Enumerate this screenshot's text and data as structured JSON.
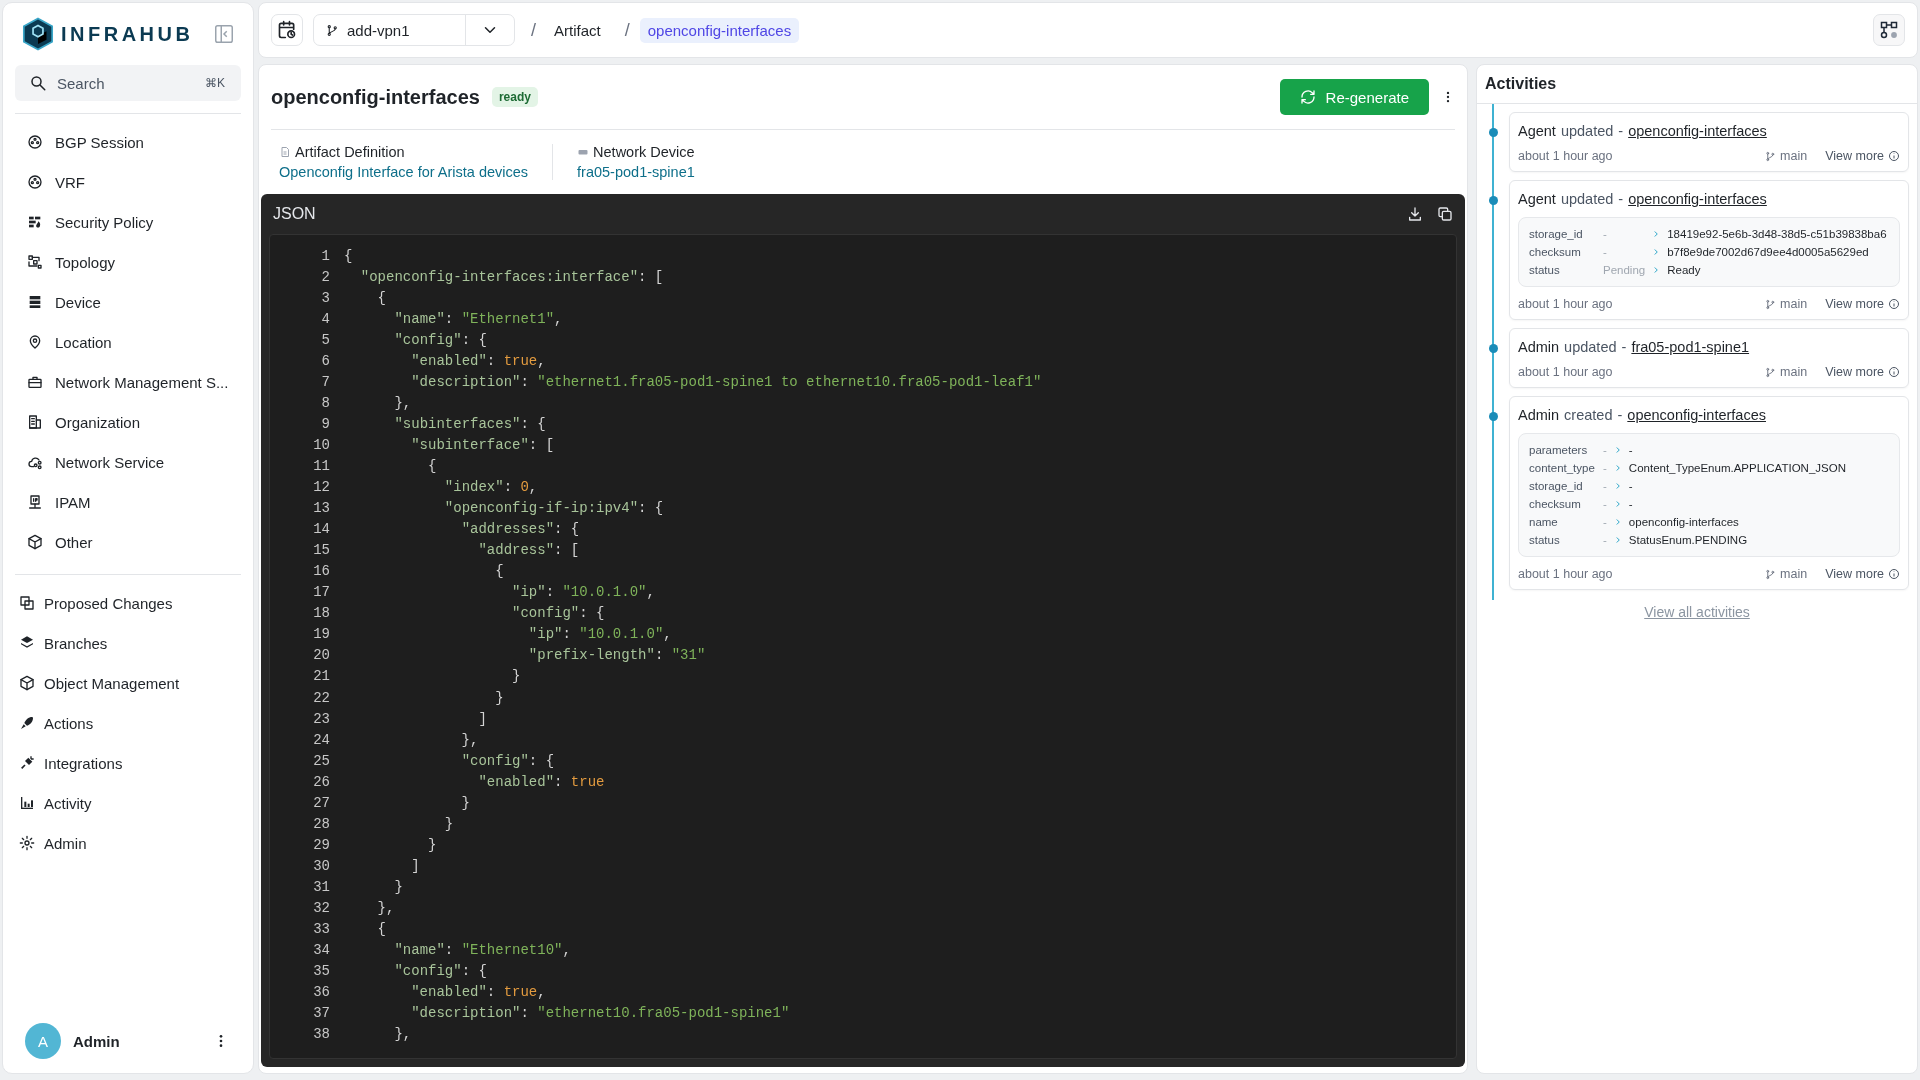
{
  "sidebar": {
    "logo": "INFRAHUB",
    "search": {
      "placeholder": "Search",
      "shortcut": "⌘K"
    },
    "groups": [
      {
        "items": [
          {
            "label": "BGP Session"
          },
          {
            "label": "VRF"
          },
          {
            "label": "Security Policy"
          },
          {
            "label": "Topology"
          },
          {
            "label": "Device"
          },
          {
            "label": "Location"
          },
          {
            "label": "Network Management S..."
          },
          {
            "label": "Organization"
          },
          {
            "label": "Network Service"
          },
          {
            "label": "IPAM"
          },
          {
            "label": "Other"
          }
        ]
      },
      {
        "items": [
          {
            "label": "Proposed Changes"
          },
          {
            "label": "Branches"
          },
          {
            "label": "Object Management"
          },
          {
            "label": "Actions"
          },
          {
            "label": "Integrations"
          },
          {
            "label": "Activity"
          },
          {
            "label": "Admin"
          }
        ]
      }
    ],
    "user": {
      "initial": "A",
      "name": "Admin"
    }
  },
  "topbar": {
    "branch": "add-vpn1",
    "breadcrumbs": [
      {
        "separator": "/",
        "label": "Artifact",
        "current": false
      },
      {
        "separator": "/",
        "label": "openconfig-interfaces",
        "current": true
      }
    ]
  },
  "artifact": {
    "title": "openconfig-interfaces",
    "status": "ready",
    "action": "Re-generate",
    "properties": [
      {
        "label": "Artifact Definition",
        "value": "Openconfig Interface for Arista devices"
      },
      {
        "label": "Network Device",
        "value": "fra05-pod1-spine1"
      }
    ],
    "code": {
      "title": "JSON",
      "lines": [
        {
          "number": "1",
          "text": "{"
        },
        {
          "number": "2",
          "text": "  \"openconfig-interfaces:interface\": ["
        },
        {
          "number": "3",
          "text": "    {"
        },
        {
          "number": "4",
          "text": "      \"name\": \"Ethernet1\","
        },
        {
          "number": "5",
          "text": "      \"config\": {"
        },
        {
          "number": "6",
          "text": "        \"enabled\": true,"
        },
        {
          "number": "7",
          "text": "        \"description\": \"ethernet1.fra05-pod1-spine1 to ethernet10.fra05-pod1-leaf1\""
        },
        {
          "number": "8",
          "text": "      },"
        },
        {
          "number": "9",
          "text": "      \"subinterfaces\": {"
        },
        {
          "number": "10",
          "text": "        \"subinterface\": ["
        },
        {
          "number": "11",
          "text": "          {"
        },
        {
          "number": "12",
          "text": "            \"index\": 0,"
        },
        {
          "number": "13",
          "text": "            \"openconfig-if-ip:ipv4\": {"
        },
        {
          "number": "14",
          "text": "              \"addresses\": {"
        },
        {
          "number": "15",
          "text": "                \"address\": ["
        },
        {
          "number": "16",
          "text": "                  {"
        },
        {
          "number": "17",
          "text": "                    \"ip\": \"10.0.1.0\","
        },
        {
          "number": "18",
          "text": "                    \"config\": {"
        },
        {
          "number": "19",
          "text": "                      \"ip\": \"10.0.1.0\","
        },
        {
          "number": "20",
          "text": "                      \"prefix-length\": \"31\""
        },
        {
          "number": "21",
          "text": "                    }"
        },
        {
          "number": "22",
          "text": "                  }"
        },
        {
          "number": "23",
          "text": "                ]"
        },
        {
          "number": "24",
          "text": "              },"
        },
        {
          "number": "25",
          "text": "              \"config\": {"
        },
        {
          "number": "26",
          "text": "                \"enabled\": true"
        },
        {
          "number": "27",
          "text": "              }"
        },
        {
          "number": "28",
          "text": "            }"
        },
        {
          "number": "29",
          "text": "          }"
        },
        {
          "number": "30",
          "text": "        ]"
        },
        {
          "number": "31",
          "text": "      }"
        },
        {
          "number": "32",
          "text": "    },"
        },
        {
          "number": "33",
          "text": "    {"
        },
        {
          "number": "34",
          "text": "      \"name\": \"Ethernet10\","
        },
        {
          "number": "35",
          "text": "      \"config\": {"
        },
        {
          "number": "36",
          "text": "        \"enabled\": true,"
        },
        {
          "number": "37",
          "text": "        \"description\": \"ethernet10.fra05-pod1-spine1\""
        },
        {
          "number": "38",
          "text": "      },"
        }
      ]
    }
  },
  "activities": {
    "title": "Activities",
    "footer_link": "View all activities",
    "items": [
      {
        "actor": "Agent",
        "action": "updated",
        "separator": "-",
        "target": "openconfig-interfaces",
        "time": "about 1 hour ago",
        "branch": "main",
        "more": "View more"
      },
      {
        "actor": "Agent",
        "action": "updated",
        "separator": "-",
        "target": "openconfig-interfaces",
        "time": "about 1 hour ago",
        "branch": "main",
        "more": "View more",
        "changes": [
          {
            "field": "storage_id",
            "old": "-",
            "new": "18419e92-5e6b-3d48-38d5-c51b39838ba6"
          },
          {
            "field": "checksum",
            "old": "-",
            "new": "b7f8e9de7002d67d9ee4d0005a5629ed"
          },
          {
            "field": "status",
            "old": "Pending",
            "new": "Ready"
          }
        ]
      },
      {
        "actor": "Admin",
        "action": "updated",
        "separator": "-",
        "target": "fra05-pod1-spine1",
        "time": "about 1 hour ago",
        "branch": "main",
        "more": "View more"
      },
      {
        "actor": "Admin",
        "action": "created",
        "separator": "-",
        "target": "openconfig-interfaces",
        "time": "about 1 hour ago",
        "branch": "main",
        "more": "View more",
        "changes": [
          {
            "field": "parameters",
            "old": "-",
            "new": "-"
          },
          {
            "field": "content_type",
            "old": "-",
            "new": "Content_TypeEnum.APPLICATION_JSON"
          },
          {
            "field": "storage_id",
            "old": "-",
            "new": "-"
          },
          {
            "field": "checksum",
            "old": "-",
            "new": "-"
          },
          {
            "field": "name",
            "old": "-",
            "new": "openconfig-interfaces"
          },
          {
            "field": "status",
            "old": "-",
            "new": "StatusEnum.PENDING"
          }
        ]
      }
    ]
  }
}
